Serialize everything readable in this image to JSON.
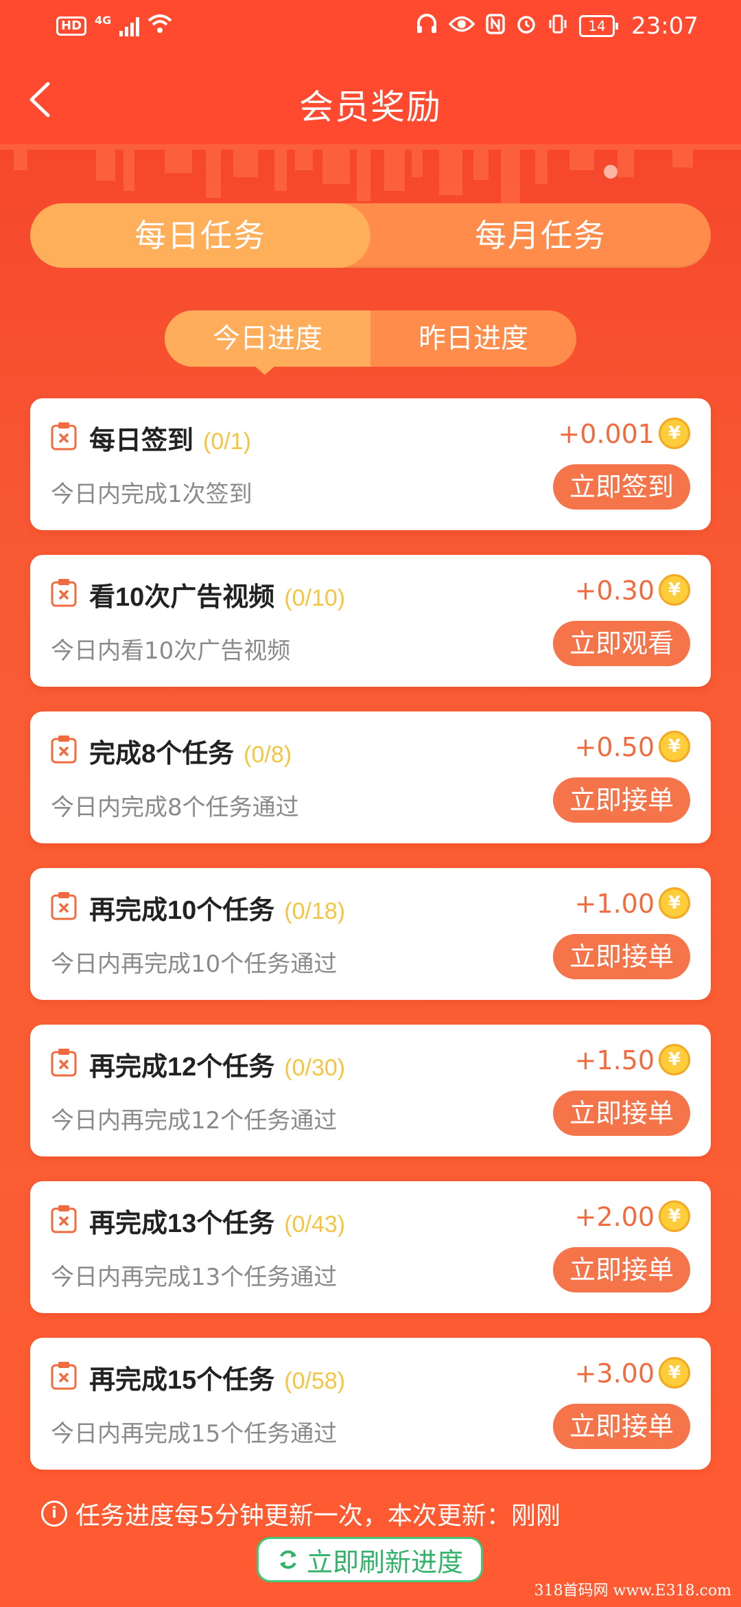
{
  "status_bar": {
    "hd": "HD",
    "network": "4G",
    "battery": "14",
    "time": "23:07"
  },
  "header": {
    "title": "会员奖励"
  },
  "main_tabs": {
    "daily": "每日任务",
    "monthly": "每月任务"
  },
  "progress_tabs": {
    "today": "今日进度",
    "yesterday": "昨日进度"
  },
  "tasks": [
    {
      "title": "每日签到",
      "count": "(0/1)",
      "desc": "今日内完成1次签到",
      "reward": "+0.001",
      "button": "立即签到"
    },
    {
      "title": "看10次广告视频",
      "count": "(0/10)",
      "desc": "今日内看10次广告视频",
      "reward": "+0.30",
      "button": "立即观看"
    },
    {
      "title": "完成8个任务",
      "count": "(0/8)",
      "desc": "今日内完成8个任务通过",
      "reward": "+0.50",
      "button": "立即接单"
    },
    {
      "title": "再完成10个任务",
      "count": "(0/18)",
      "desc": "今日内再完成10个任务通过",
      "reward": "+1.00",
      "button": "立即接单"
    },
    {
      "title": "再完成12个任务",
      "count": "(0/30)",
      "desc": "今日内再完成12个任务通过",
      "reward": "+1.50",
      "button": "立即接单"
    },
    {
      "title": "再完成13个任务",
      "count": "(0/43)",
      "desc": "今日内再完成13个任务通过",
      "reward": "+2.00",
      "button": "立即接单"
    },
    {
      "title": "再完成15个任务",
      "count": "(0/58)",
      "desc": "今日内再完成15个任务通过",
      "reward": "+3.00",
      "button": "立即接单"
    }
  ],
  "coin_symbol": "¥",
  "footer": {
    "info_symbol": "i",
    "notice": "任务进度每5分钟更新一次，本次更新：刚刚",
    "refresh_label": "立即刷新进度"
  },
  "watermark": "318首码网 www.E318.com",
  "colors": {
    "background": "#f85a34",
    "header": "#ff4a2f",
    "tab_active": "#ffae5a",
    "tab_inactive": "#ff8c4a",
    "button": "#f5744a",
    "reward": "#f26b3e",
    "count": "#f5c442",
    "refresh": "#33b36a"
  }
}
